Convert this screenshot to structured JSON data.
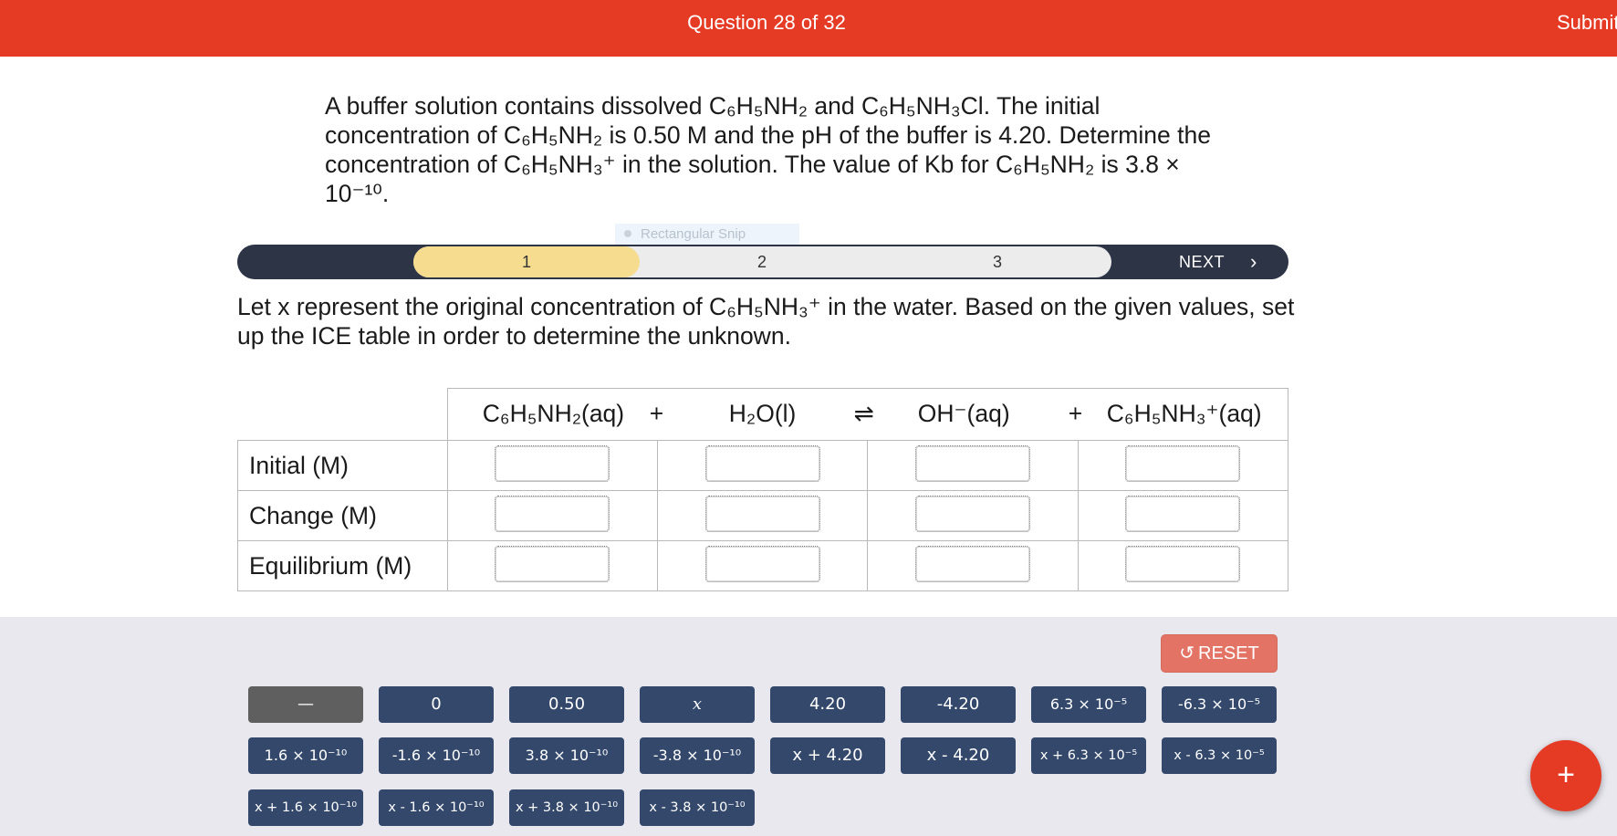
{
  "header": {
    "question_counter": "Question 28 of 32",
    "submit_label": "Submit"
  },
  "question_text": "A buffer solution contains dissolved C₆H₅NH₂ and C₆H₅NH₃Cl. The initial concentration of C₆H₅NH₂ is 0.50 M and the pH of the buffer is 4.20. Determine the concentration of C₆H₅NH₃⁺ in the solution. The value of Kb for C₆H₅NH₂ is 3.8 × 10⁻¹⁰.",
  "overlay": {
    "snip_label": "Rectangular Snip"
  },
  "steps": {
    "items": [
      "1",
      "2",
      "3"
    ],
    "next_label": "NEXT",
    "next_icon": "›",
    "active_step": 1
  },
  "prompt_text": "Let x represent the original concentration of C₆H₅NH₃⁺ in the water. Based on the given values, set up the ICE table in order to determine the unknown.",
  "ice_table": {
    "species": [
      "C₆H₅NH₂(aq)",
      "H₂O(l)",
      "OH⁻(aq)",
      "C₆H₅NH₃⁺(aq)"
    ],
    "operators": [
      "+",
      "⇌",
      "+"
    ],
    "rows": [
      "Initial (M)",
      "Change (M)",
      "Equilibrium (M)"
    ]
  },
  "reset_label": "RESET",
  "reset_icon": "↺",
  "tiles": [
    "—",
    "0",
    "0.50",
    "x",
    "4.20",
    "-4.20",
    "6.3 × 10⁻⁵",
    "-6.3 × 10⁻⁵",
    "1.6 × 10⁻¹⁰",
    "-1.6 × 10⁻¹⁰",
    "3.8 × 10⁻¹⁰",
    "-3.8 × 10⁻¹⁰",
    "x + 4.20",
    "x - 4.20",
    "x + 6.3 × 10⁻⁵",
    "x - 6.3 × 10⁻⁵",
    "x + 1.6 × 10⁻¹⁰",
    "x - 1.6 × 10⁻¹⁰",
    "x + 3.8 × 10⁻¹⁰",
    "x - 3.8 × 10⁻¹⁰"
  ],
  "fab_label": "+",
  "colors": {
    "header_red": "#e53a24",
    "tile_navy": "#33486b",
    "tile_gray": "#5f5f5f",
    "step_bar": "#2c3446",
    "step_active": "#f5dc8f",
    "reset_salmon": "#e27365",
    "tray_bg": "#e9e8ef"
  }
}
